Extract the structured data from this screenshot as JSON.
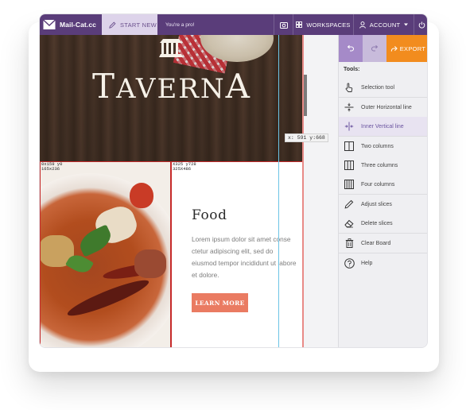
{
  "app": {
    "logo_text": "Mail-Cat.cc",
    "start_new_label": "START NEW",
    "promo_text": "You're a pro!",
    "workspaces_label": "WORKSPACES",
    "account_label": "ACCOUNT"
  },
  "canvas": {
    "hero_title_first": "T",
    "hero_title_mid": "AVERN",
    "hero_title_last": "A",
    "slice_label_left": "0x159 y0\n165x236",
    "slice_label_right": "X325 y728\n325X486",
    "food_heading": "Food",
    "food_body": "Lorem ipsum dolor sit amet conse ctetur adipiscing elit, sed do eiusmod tempor incididunt ut labore et dolore.",
    "learn_more_label": "LEARN MORE",
    "coord_readout": "x: 591 y:668"
  },
  "panel": {
    "export_label": "EXPORT",
    "tools_title": "Tools:",
    "tools": [
      {
        "label": "Selection tool",
        "icon": "hand-pointer-icon"
      },
      {
        "label": "Outer Horizontal line",
        "icon": "horizontal-line-icon"
      },
      {
        "label": "Inner Vertical line",
        "icon": "vertical-line-icon",
        "active": true
      },
      {
        "label": "Two columns",
        "icon": "two-columns-icon"
      },
      {
        "label": "Three columns",
        "icon": "three-columns-icon"
      },
      {
        "label": "Four columns",
        "icon": "four-columns-icon"
      },
      {
        "label": "Adjust slices",
        "icon": "pencil-icon"
      },
      {
        "label": "Delete slices",
        "icon": "eraser-icon"
      },
      {
        "label": "Clear Board",
        "icon": "trash-icon"
      },
      {
        "label": "Help",
        "icon": "help-icon"
      }
    ]
  },
  "colors": {
    "topbar": "#5a3d7a",
    "accent": "#6b55a0",
    "export": "#f28c1e",
    "cta": "#ea7b62"
  }
}
